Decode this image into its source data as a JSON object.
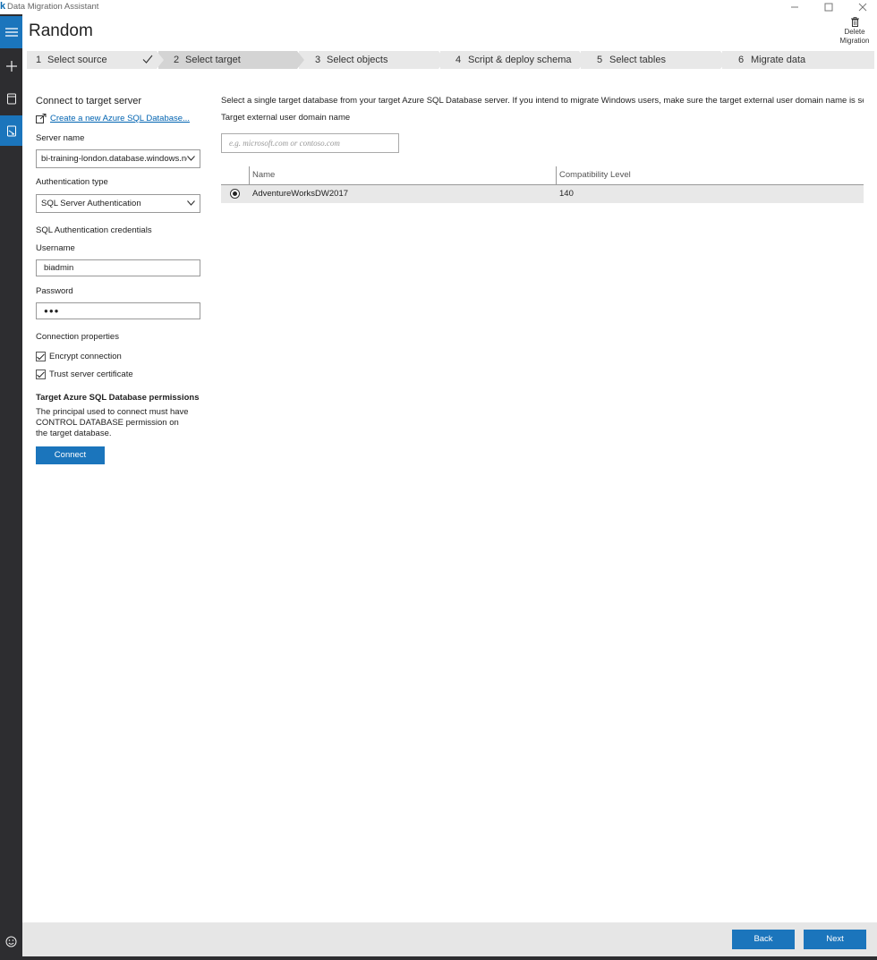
{
  "window": {
    "title": "Data Migration Assistant"
  },
  "header": {
    "project_title": "Random",
    "delete_label_line1": "Delete",
    "delete_label_line2": "Migration"
  },
  "steps": [
    {
      "number": "1",
      "label": "Select source",
      "completed": true
    },
    {
      "number": "2",
      "label": "Select target",
      "current": true
    },
    {
      "number": "3",
      "label": "Select objects"
    },
    {
      "number": "4",
      "label": "Script & deploy schema"
    },
    {
      "number": "5",
      "label": "Select tables"
    },
    {
      "number": "6",
      "label": "Migrate data"
    }
  ],
  "connect_panel": {
    "heading": "Connect to target server",
    "create_link": "Create a new Azure SQL Database...",
    "server_name_label": "Server name",
    "server_name_value": "bi-training-london.database.windows.net",
    "auth_type_label": "Authentication type",
    "auth_type_value": "SQL Server Authentication",
    "credentials_heading": "SQL Authentication credentials",
    "username_label": "Username",
    "username_value": "biadmin",
    "password_label": "Password",
    "password_value": "●●●",
    "conn_props_heading": "Connection properties",
    "encrypt_label": "Encrypt connection",
    "encrypt_checked": true,
    "trust_label": "Trust server certificate",
    "trust_checked": true,
    "permissions_title": "Target Azure SQL Database permissions",
    "permissions_text": "The principal used to connect must have CONTROL DATABASE permission on the target database.",
    "connect_button": "Connect"
  },
  "target_panel": {
    "instruction": "Select a single target database from your target Azure SQL Database server. If you intend to migrate Windows users, make sure the target external user domain name is set corre",
    "domain_label": "Target external user domain name",
    "domain_placeholder": "e.g. microsoft.com or contoso.com",
    "columns": [
      "Name",
      "Compatibility Level"
    ],
    "rows": [
      {
        "selected": true,
        "name": "AdventureWorksDW2017",
        "compat": "140"
      }
    ]
  },
  "footer": {
    "back_label": "Back",
    "next_label": "Next"
  },
  "colors": {
    "accent": "#1b75bc",
    "rail": "#2d2d30",
    "link": "#0063b1"
  }
}
